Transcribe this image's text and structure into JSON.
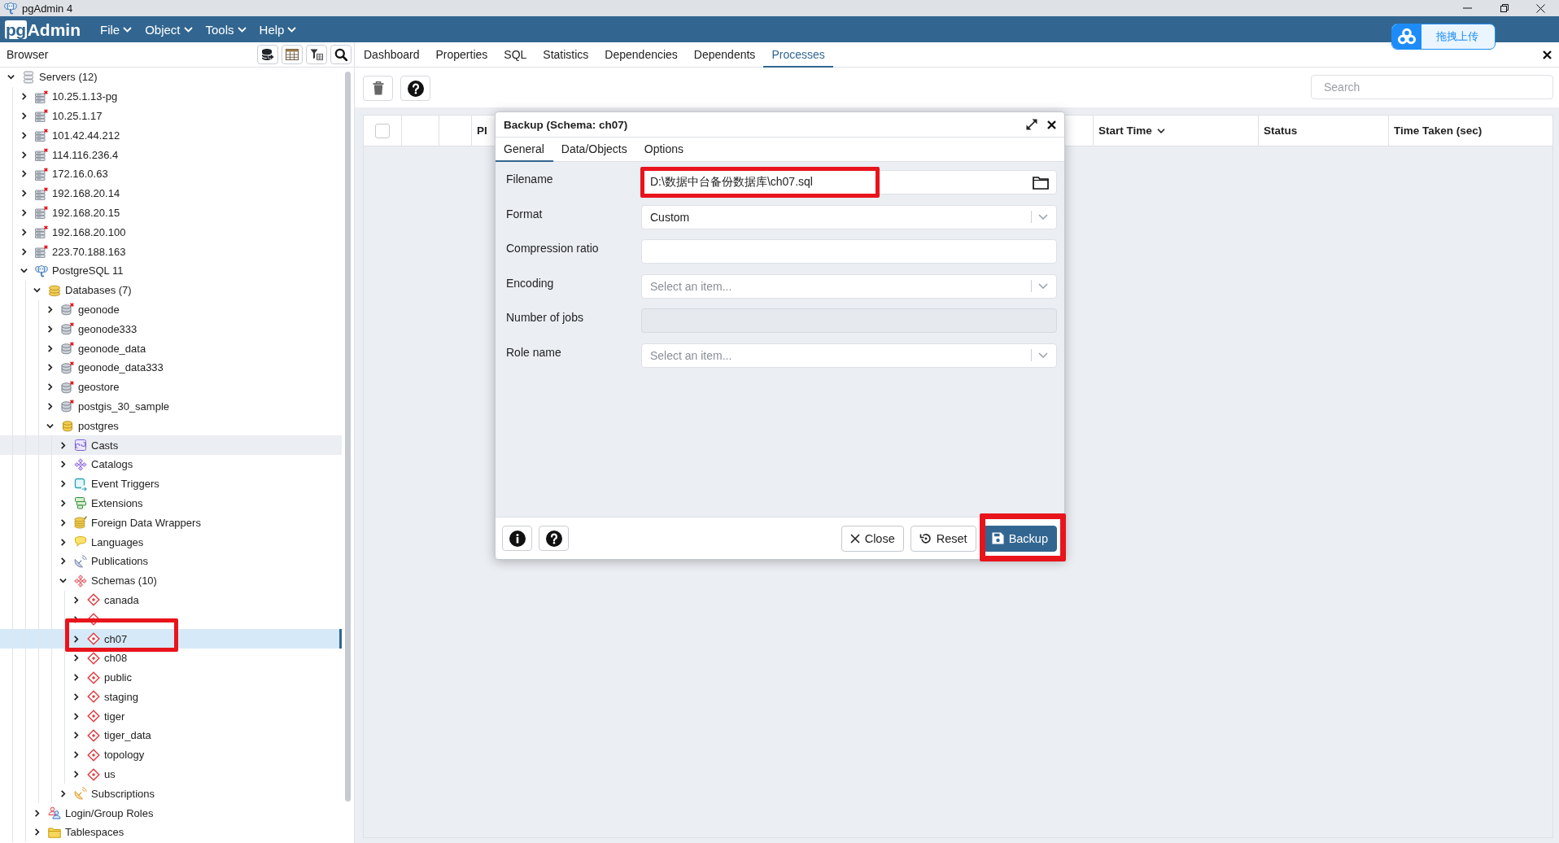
{
  "window": {
    "title": "pgAdmin 4"
  },
  "menu_bar": {
    "logo": {
      "badge": "pg",
      "text": "Admin"
    },
    "menus": [
      "File",
      "Object",
      "Tools",
      "Help"
    ]
  },
  "upload_widget": {
    "label": "拖拽上传"
  },
  "browser": {
    "title": "Browser",
    "tree": [
      {
        "label": "Servers (12)",
        "kind": "server-group",
        "expanded": true,
        "selected": false,
        "hovered": false,
        "highlighted": false,
        "children": [
          {
            "label": "10.25.1.13-pg",
            "kind": "server-off",
            "expanded": false,
            "selected": false,
            "hovered": false,
            "highlighted": false
          },
          {
            "label": "10.25.1.17",
            "kind": "server-off",
            "expanded": false,
            "selected": false,
            "hovered": false,
            "highlighted": false
          },
          {
            "label": "101.42.44.212",
            "kind": "server-off",
            "expanded": false,
            "selected": false,
            "hovered": false,
            "highlighted": false
          },
          {
            "label": "114.116.236.4",
            "kind": "server-off",
            "expanded": false,
            "selected": false,
            "hovered": false,
            "highlighted": false
          },
          {
            "label": "172.16.0.63",
            "kind": "server-off",
            "expanded": false,
            "selected": false,
            "hovered": false,
            "highlighted": false
          },
          {
            "label": "192.168.20.14",
            "kind": "server-off",
            "expanded": false,
            "selected": false,
            "hovered": false,
            "highlighted": false
          },
          {
            "label": "192.168.20.15",
            "kind": "server-off",
            "expanded": false,
            "selected": false,
            "hovered": false,
            "highlighted": false
          },
          {
            "label": "192.168.20.100",
            "kind": "server-off",
            "expanded": false,
            "selected": false,
            "hovered": false,
            "highlighted": false
          },
          {
            "label": "223.70.188.163",
            "kind": "server-off",
            "expanded": false,
            "selected": false,
            "hovered": false,
            "highlighted": false
          },
          {
            "label": "PostgreSQL 11",
            "kind": "postgres-server",
            "expanded": true,
            "selected": false,
            "hovered": false,
            "highlighted": false,
            "children": [
              {
                "label": "Databases (7)",
                "kind": "database-group",
                "expanded": true,
                "selected": false,
                "hovered": false,
                "highlighted": false,
                "children": [
                  {
                    "label": "geonode",
                    "kind": "database-off",
                    "expanded": false,
                    "selected": false,
                    "hovered": false,
                    "highlighted": false
                  },
                  {
                    "label": "geonode333",
                    "kind": "database-off",
                    "expanded": false,
                    "selected": false,
                    "hovered": false,
                    "highlighted": false
                  },
                  {
                    "label": "geonode_data",
                    "kind": "database-off",
                    "expanded": false,
                    "selected": false,
                    "hovered": false,
                    "highlighted": false
                  },
                  {
                    "label": "geonode_data333",
                    "kind": "database-off",
                    "expanded": false,
                    "selected": false,
                    "hovered": false,
                    "highlighted": false
                  },
                  {
                    "label": "geostore",
                    "kind": "database-off",
                    "expanded": false,
                    "selected": false,
                    "hovered": false,
                    "highlighted": false
                  },
                  {
                    "label": "postgis_30_sample",
                    "kind": "database-off",
                    "expanded": false,
                    "selected": false,
                    "hovered": false,
                    "highlighted": false
                  },
                  {
                    "label": "postgres",
                    "kind": "database",
                    "expanded": true,
                    "selected": false,
                    "hovered": false,
                    "highlighted": false,
                    "children": [
                      {
                        "label": "Casts",
                        "kind": "casts",
                        "expanded": false,
                        "selected": false,
                        "hovered": true,
                        "highlighted": false
                      },
                      {
                        "label": "Catalogs",
                        "kind": "catalogs",
                        "expanded": false,
                        "selected": false,
                        "hovered": false,
                        "highlighted": false
                      },
                      {
                        "label": "Event Triggers",
                        "kind": "event-triggers",
                        "expanded": false,
                        "selected": false,
                        "hovered": false,
                        "highlighted": false
                      },
                      {
                        "label": "Extensions",
                        "kind": "extensions",
                        "expanded": false,
                        "selected": false,
                        "hovered": false,
                        "highlighted": false
                      },
                      {
                        "label": "Foreign Data Wrappers",
                        "kind": "fdw",
                        "expanded": false,
                        "selected": false,
                        "hovered": false,
                        "highlighted": false
                      },
                      {
                        "label": "Languages",
                        "kind": "languages",
                        "expanded": false,
                        "selected": false,
                        "hovered": false,
                        "highlighted": false
                      },
                      {
                        "label": "Publications",
                        "kind": "publications",
                        "expanded": false,
                        "selected": false,
                        "hovered": false,
                        "highlighted": false
                      },
                      {
                        "label": "Schemas (10)",
                        "kind": "schema-group",
                        "expanded": true,
                        "selected": false,
                        "hovered": false,
                        "highlighted": false,
                        "children": [
                          {
                            "label": "canada",
                            "kind": "schema",
                            "expanded": false,
                            "selected": false,
                            "hovered": false,
                            "highlighted": false
                          },
                          {
                            "kind": "schema",
                            "expanded": false,
                            "selected": false,
                            "hovered": false,
                            "highlighted": false
                          },
                          {
                            "label": "ch07",
                            "kind": "schema",
                            "expanded": false,
                            "selected": true,
                            "hovered": false,
                            "highlighted": true
                          },
                          {
                            "label": "ch08",
                            "kind": "schema",
                            "expanded": false,
                            "selected": false,
                            "hovered": false,
                            "highlighted": false
                          },
                          {
                            "label": "public",
                            "kind": "schema",
                            "expanded": false,
                            "selected": false,
                            "hovered": false,
                            "highlighted": false
                          },
                          {
                            "label": "staging",
                            "kind": "schema",
                            "expanded": false,
                            "selected": false,
                            "hovered": false,
                            "highlighted": false
                          },
                          {
                            "label": "tiger",
                            "kind": "schema",
                            "expanded": false,
                            "selected": false,
                            "hovered": false,
                            "highlighted": false
                          },
                          {
                            "label": "tiger_data",
                            "kind": "schema",
                            "expanded": false,
                            "selected": false,
                            "hovered": false,
                            "highlighted": false
                          },
                          {
                            "label": "topology",
                            "kind": "schema",
                            "expanded": false,
                            "selected": false,
                            "hovered": false,
                            "highlighted": false
                          },
                          {
                            "label": "us",
                            "kind": "schema",
                            "expanded": false,
                            "selected": false,
                            "hovered": false,
                            "highlighted": false
                          }
                        ]
                      },
                      {
                        "label": "Subscriptions",
                        "kind": "subscriptions",
                        "expanded": false,
                        "selected": false,
                        "hovered": false,
                        "highlighted": false
                      }
                    ]
                  }
                ]
              },
              {
                "label": "Login/Group Roles",
                "kind": "login-roles",
                "expanded": false,
                "selected": false,
                "hovered": false,
                "highlighted": false
              },
              {
                "label": "Tablespaces",
                "kind": "tablespaces",
                "expanded": false,
                "selected": false,
                "hovered": false,
                "highlighted": false
              }
            ]
          }
        ]
      }
    ]
  },
  "main_tabs": [
    {
      "label": "Dashboard",
      "selected": false
    },
    {
      "label": "Properties",
      "selected": false
    },
    {
      "label": "SQL",
      "selected": false
    },
    {
      "label": "Statistics",
      "selected": false
    },
    {
      "label": "Dependencies",
      "selected": false
    },
    {
      "label": "Dependents",
      "selected": false
    },
    {
      "label": "Processes",
      "selected": true
    }
  ],
  "processes": {
    "search": {
      "placeholder": "Search"
    },
    "select_all": {
      "checked": false
    },
    "columns": [
      {
        "kind": "checkbox",
        "sorted": false
      },
      {
        "kind": "blank",
        "sorted": false
      },
      {
        "kind": "blank",
        "sorted": false
      },
      {
        "kind": "text",
        "label": "PI",
        "sorted": false
      },
      {
        "kind": "text",
        "label": "Start Time",
        "sorted": true
      },
      {
        "kind": "text",
        "label": "Status",
        "sorted": false
      },
      {
        "kind": "text",
        "label": "Time Taken (sec)",
        "sorted": false
      }
    ]
  },
  "backup_dialog": {
    "title": "Backup (Schema: ch07)",
    "tabs": [
      {
        "label": "General",
        "selected": true
      },
      {
        "label": "Data/Objects",
        "selected": false
      },
      {
        "label": "Options",
        "selected": false
      }
    ],
    "fields": [
      {
        "label": "Filename",
        "kind": "file",
        "value": "D:\\数据中台备份数据库\\ch07.sql",
        "disabled": false,
        "highlighted": true
      },
      {
        "label": "Format",
        "kind": "select",
        "value": "Custom",
        "disabled": false,
        "highlighted": false
      },
      {
        "label": "Compression ratio",
        "kind": "text",
        "disabled": false,
        "highlighted": false
      },
      {
        "label": "Encoding",
        "kind": "select",
        "placeholder": "Select an item...",
        "disabled": false,
        "highlighted": false
      },
      {
        "label": "Number of jobs",
        "kind": "text",
        "disabled": true,
        "highlighted": false
      },
      {
        "label": "Role name",
        "kind": "select",
        "placeholder": "Select an item...",
        "disabled": false,
        "highlighted": false
      }
    ],
    "buttons": [
      {
        "label": "Close",
        "kind": "close",
        "primary": false,
        "highlighted": false
      },
      {
        "label": "Reset",
        "kind": "reset",
        "primary": false,
        "highlighted": false
      },
      {
        "label": "Backup",
        "kind": "backup",
        "primary": true,
        "highlighted": true
      }
    ]
  }
}
